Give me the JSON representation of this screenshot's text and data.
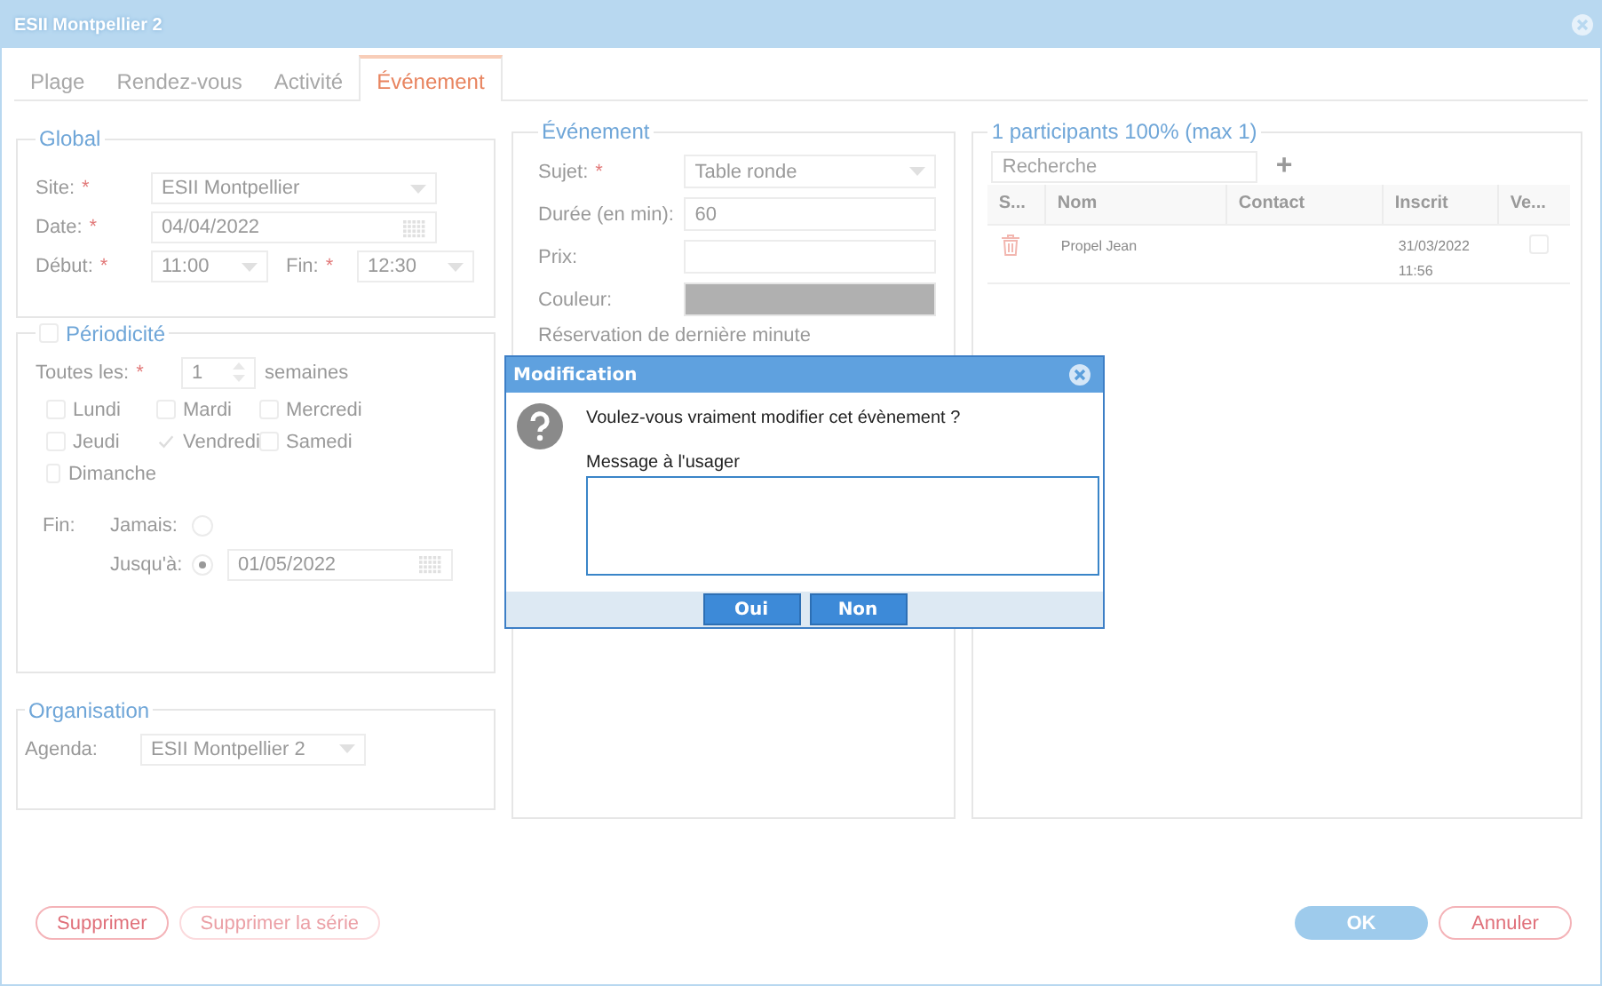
{
  "window": {
    "title": "ESII Montpellier 2"
  },
  "tabs": [
    {
      "label": "Plage",
      "selected": false
    },
    {
      "label": "Rendez-vous",
      "selected": false
    },
    {
      "label": "Activité",
      "selected": false
    },
    {
      "label": "Événement",
      "selected": true
    }
  ],
  "global": {
    "legend": "Global",
    "fields": [
      {
        "kind": "select",
        "label": "Site:",
        "mark": "*",
        "value": "ESII Montpellier"
      },
      {
        "kind": "date",
        "label": "Date:",
        "mark": "*",
        "value": "04/04/2022"
      },
      {
        "kind": "time_pair",
        "label": "Début:",
        "mark": "*",
        "value": "11:00",
        "label_2": "Fin:",
        "mark_2": "*",
        "value_2": "12:30"
      }
    ]
  },
  "periodicity": {
    "legend": "Périodicité",
    "checked": false,
    "every_label": "Toutes les:",
    "every_mark": "*",
    "every_value": "1",
    "unit": "semaines",
    "days": [
      {
        "label": "Lundi",
        "checked": false
      },
      {
        "label": "Mardi",
        "checked": false
      },
      {
        "label": "Mercredi",
        "checked": false
      },
      {
        "label": "Jeudi",
        "checked": false
      },
      {
        "label": "Vendredi",
        "checked": true
      },
      {
        "label": "Samedi",
        "checked": false
      },
      {
        "label": "Dimanche",
        "checked": false
      }
    ],
    "end_label": "Fin:",
    "end_options": [
      {
        "label": "Jamais:",
        "selected": false
      },
      {
        "label": "Jusqu'à:",
        "selected": true,
        "value": "01/05/2022"
      }
    ]
  },
  "organisation": {
    "legend": "Organisation",
    "label": "Agenda:",
    "value": "ESII Montpellier 2"
  },
  "event": {
    "legend": "Événement",
    "fields": [
      {
        "kind": "select",
        "label": "Sujet:",
        "mark": "*",
        "value": "Table ronde"
      },
      {
        "kind": "text",
        "label": "Durée (en min):",
        "value": "60"
      },
      {
        "kind": "text",
        "label": "Prix:"
      },
      {
        "kind": "color",
        "label": "Couleur:",
        "color": "#b0b0b0"
      }
    ],
    "note": "Réservation de dernière minute"
  },
  "participants": {
    "legend": "1 participants 100% (max 1)",
    "search_placeholder": "Recherche",
    "add": "+",
    "columns": [
      "S...",
      "Nom",
      "Contact",
      "Inscrit",
      "Ve..."
    ],
    "rows": [
      {
        "name": "Propel Jean",
        "registered": "31/03/2022 11:56",
        "checked": false
      }
    ]
  },
  "footer": {
    "left": [
      {
        "label": "Supprimer",
        "disabled": false
      },
      {
        "label": "Supprimer la série",
        "disabled": true
      }
    ],
    "right": [
      {
        "label": "OK",
        "kind": "primary"
      },
      {
        "label": "Annuler",
        "kind": "secondary"
      }
    ]
  },
  "dialog": {
    "title": "Modification",
    "question": "Voulez-vous vraiment modifier cet évènement ?",
    "message_label": "Message à l'usager",
    "buttons": [
      "Oui",
      "Non"
    ]
  }
}
